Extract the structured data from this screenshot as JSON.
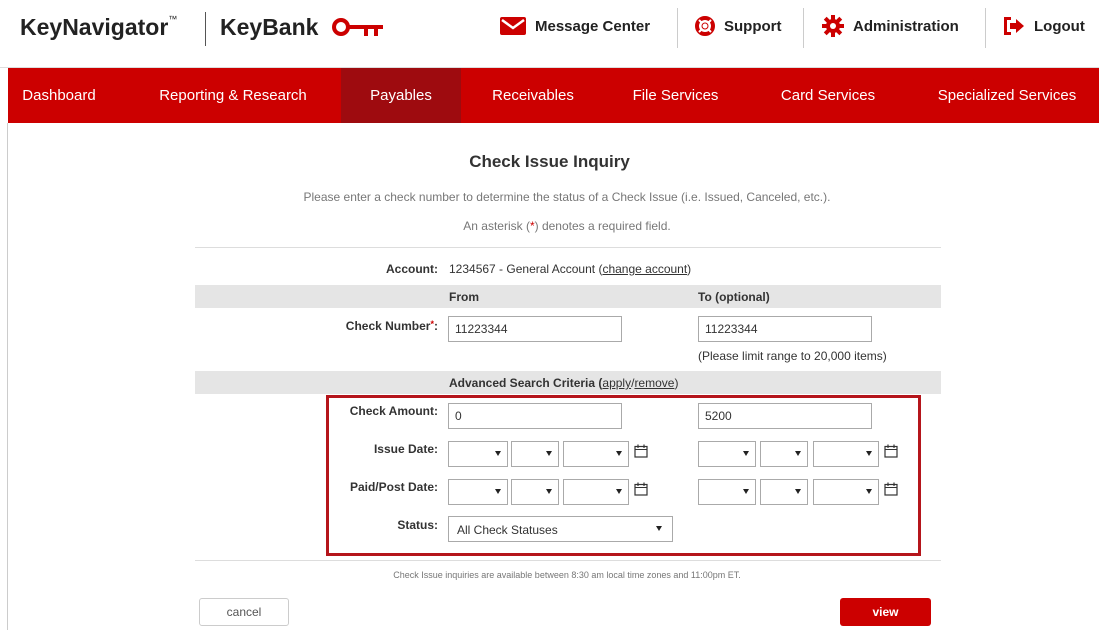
{
  "header": {
    "brand_left": "KeyNavigator",
    "brand_tm": "™",
    "brand_right": "KeyBank",
    "links": [
      {
        "label": "Message Center",
        "icon": "envelope-icon"
      },
      {
        "label": "Support",
        "icon": "lifebuoy-icon"
      },
      {
        "label": "Administration",
        "icon": "gear-icon"
      },
      {
        "label": "Logout",
        "icon": "logout-arrow-icon"
      }
    ],
    "accent": "#cc0000"
  },
  "nav": {
    "items": [
      "Dashboard",
      "Reporting & Research",
      "Payables",
      "Receivables",
      "File Services",
      "Card Services",
      "Specialized Services"
    ],
    "active": "Payables",
    "active_color": "#9e0b0f"
  },
  "page": {
    "title": "Check Issue Inquiry",
    "instructions": "Please enter a check number to determine the status of a Check Issue (i.e. Issued, Canceled, etc.).",
    "required_prefix": "An asterisk (",
    "required_star": "*",
    "required_suffix": ") denotes a required field."
  },
  "form": {
    "account_label": "Account:",
    "account_value": "1234567 - General Account (",
    "change_account_link": "change account",
    "account_close": ")",
    "from_header": "From",
    "to_header": "To (optional)",
    "check_number_label": "Check Number",
    "check_number_from": "11223344",
    "check_number_to": "11223344",
    "range_hint": "(Please limit range to 20,000 items)",
    "advanced_title": "Advanced Search Criteria (",
    "apply_link": "apply",
    "slash": "/",
    "remove_link": "remove",
    "advanced_close": ")",
    "check_amount_label": "Check Amount:",
    "check_amount_from": "0",
    "check_amount_to": "5200",
    "issue_date_label": "Issue Date:",
    "paid_post_date_label": "Paid/Post Date:",
    "status_label": "Status:",
    "status_value": "All Check Statuses",
    "highlight_color": "#b5151b"
  },
  "footer": {
    "note": "Check Issue inquiries are available between 8:30 am local time zones and 11:00pm ET.",
    "cancel_label": "cancel",
    "view_label": "view"
  }
}
